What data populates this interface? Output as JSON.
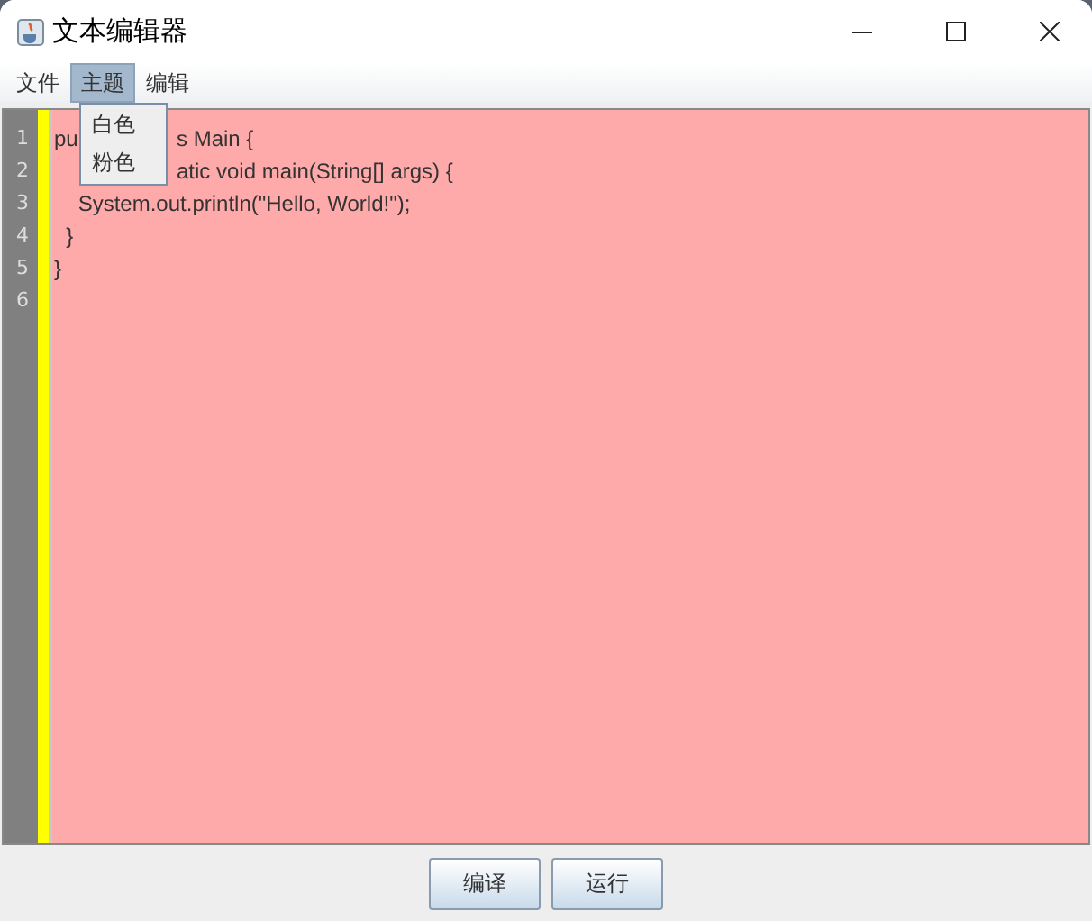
{
  "window": {
    "title": "文本编辑器"
  },
  "menu_bar": [
    {
      "label": "文件",
      "selected": false
    },
    {
      "label": "主题",
      "selected": true
    },
    {
      "label": "编辑",
      "selected": false
    }
  ],
  "theme_menu": {
    "items": [
      "白色",
      "粉色"
    ]
  },
  "editor": {
    "line_numbers": [
      "1",
      "2",
      "3",
      "4",
      "5",
      "6"
    ],
    "lines": [
      {
        "left": "pu",
        "right": "s Main {"
      },
      {
        "right": "atic void main(String[] args) {"
      },
      {
        "left": "    System.out.println(\"Hello, World!\");"
      },
      {
        "left": "  }"
      },
      {
        "left": "}"
      }
    ]
  },
  "buttons": [
    "编译",
    "运行"
  ]
}
